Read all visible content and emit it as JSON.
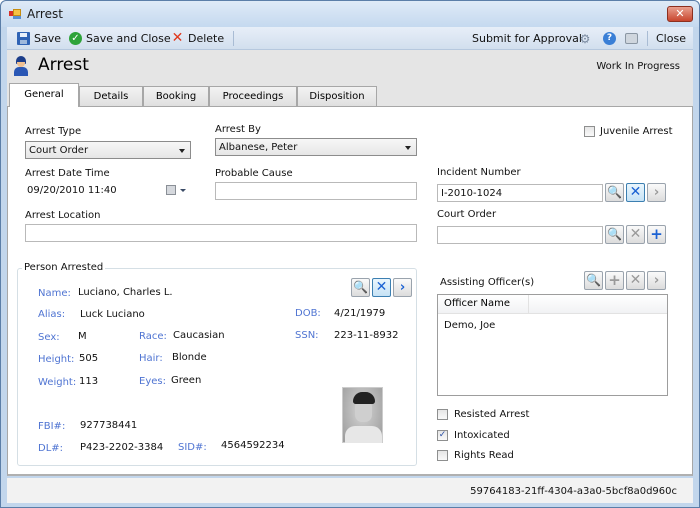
{
  "window": {
    "title": "Arrest",
    "close_glyph": "✕"
  },
  "toolbar": {
    "save": "Save",
    "save_and_close": "Save and Close",
    "delete": "Delete",
    "submit_for_approval": "Submit for Approval",
    "close": "Close",
    "icons": [
      "save-icon",
      "check-icon",
      "delete-icon",
      "workflow-icon",
      "help-icon",
      "print-icon"
    ]
  },
  "header": {
    "title": "Arrest",
    "status": "Work In Progress"
  },
  "tabs": [
    {
      "label": "General",
      "active": true
    },
    {
      "label": "Details",
      "active": false
    },
    {
      "label": "Booking",
      "active": false
    },
    {
      "label": "Proceedings",
      "active": false
    },
    {
      "label": "Disposition",
      "active": false
    }
  ],
  "form": {
    "arrest_type": {
      "label": "Arrest Type",
      "value": "Court Order"
    },
    "arrest_by": {
      "label": "Arrest By",
      "value": "Albanese, Peter"
    },
    "arrest_date_time": {
      "label": "Arrest Date Time",
      "value": "09/20/2010 11:40"
    },
    "probable_cause": {
      "label": "Probable Cause",
      "value": ""
    },
    "arrest_location": {
      "label": "Arrest Location",
      "value": ""
    },
    "juvenile_arrest": {
      "label": "Juvenile Arrest",
      "checked": false
    },
    "incident_number": {
      "label": "Incident Number",
      "value": "I-2010-1024"
    },
    "court_order": {
      "label": "Court Order",
      "value": ""
    }
  },
  "person": {
    "group_title": "Person Arrested",
    "labels": {
      "name": "Name:",
      "alias": "Alias:",
      "sex": "Sex:",
      "height": "Height:",
      "weight": "Weight:",
      "race": "Race:",
      "hair": "Hair:",
      "eyes": "Eyes:",
      "dob": "DOB:",
      "ssn": "SSN:",
      "fbi": "FBI#:",
      "dl": "DL#:",
      "sid": "SID#:"
    },
    "values": {
      "name": "Luciano, Charles L.",
      "alias": "Luck Luciano",
      "sex": "M",
      "height": "505",
      "weight": "113",
      "race": "Caucasian",
      "hair": "Blonde",
      "eyes": "Green",
      "dob": "4/21/1979",
      "ssn": "223-11-8932",
      "fbi": "927738441",
      "dl": "P423-2202-3384",
      "sid": "4564592234"
    }
  },
  "assisting_officers": {
    "label": "Assisting Officer(s)",
    "columns": [
      "Officer Name",
      ""
    ],
    "rows": [
      "Demo, Joe"
    ]
  },
  "flags": [
    {
      "label": "Resisted Arrest",
      "checked": false
    },
    {
      "label": "Intoxicated",
      "checked": true
    },
    {
      "label": "Rights Read",
      "checked": false
    }
  ],
  "footer": {
    "record_id": "59764183-21ff-4304-a3a0-5bcf8a0d960c"
  },
  "glyphs": {
    "search": "🔍",
    "x": "✕",
    "next": "›",
    "plus": "+",
    "check": "✓"
  }
}
